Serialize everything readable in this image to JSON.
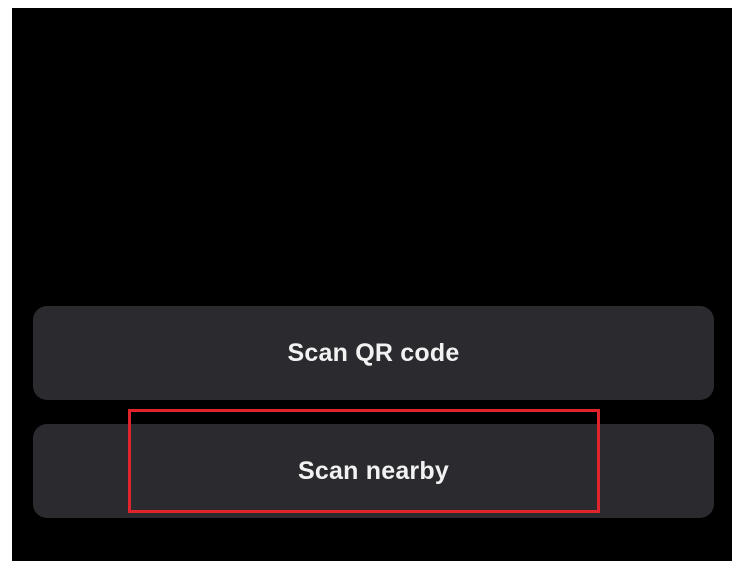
{
  "actions": {
    "scan_qr_label": "Scan QR code",
    "scan_nearby_label": "Scan nearby"
  },
  "colors": {
    "background": "#000000",
    "button": "#2b2a2f",
    "button_text": "#f2f2f2",
    "highlight": "#e1242c"
  }
}
